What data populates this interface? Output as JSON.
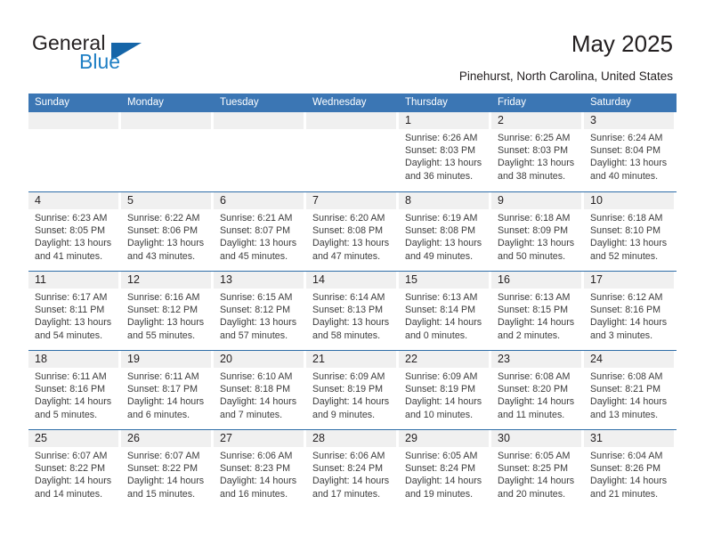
{
  "brand": {
    "name_top": "General",
    "name_bottom": "Blue",
    "triangle_color": "#1565a8",
    "blue_text_color": "#1f7fc4"
  },
  "header": {
    "title": "May 2025",
    "location": "Pinehurst, North Carolina, United States"
  },
  "colors": {
    "header_blue": "#3b76b4",
    "row_separator": "#2e6da8",
    "daynum_band": "#f0f0f0"
  },
  "weekdays": [
    "Sunday",
    "Monday",
    "Tuesday",
    "Wednesday",
    "Thursday",
    "Friday",
    "Saturday"
  ],
  "weeks": [
    [
      {
        "day": "",
        "empty": true,
        "sunrise": "",
        "sunset": "",
        "daylight_a": "",
        "daylight_b": ""
      },
      {
        "day": "",
        "empty": true,
        "sunrise": "",
        "sunset": "",
        "daylight_a": "",
        "daylight_b": ""
      },
      {
        "day": "",
        "empty": true,
        "sunrise": "",
        "sunset": "",
        "daylight_a": "",
        "daylight_b": ""
      },
      {
        "day": "",
        "empty": true,
        "sunrise": "",
        "sunset": "",
        "daylight_a": "",
        "daylight_b": ""
      },
      {
        "day": "1",
        "empty": false,
        "sunrise": "Sunrise: 6:26 AM",
        "sunset": "Sunset: 8:03 PM",
        "daylight_a": "Daylight: 13 hours",
        "daylight_b": "and 36 minutes."
      },
      {
        "day": "2",
        "empty": false,
        "sunrise": "Sunrise: 6:25 AM",
        "sunset": "Sunset: 8:03 PM",
        "daylight_a": "Daylight: 13 hours",
        "daylight_b": "and 38 minutes."
      },
      {
        "day": "3",
        "empty": false,
        "sunrise": "Sunrise: 6:24 AM",
        "sunset": "Sunset: 8:04 PM",
        "daylight_a": "Daylight: 13 hours",
        "daylight_b": "and 40 minutes."
      }
    ],
    [
      {
        "day": "4",
        "empty": false,
        "sunrise": "Sunrise: 6:23 AM",
        "sunset": "Sunset: 8:05 PM",
        "daylight_a": "Daylight: 13 hours",
        "daylight_b": "and 41 minutes."
      },
      {
        "day": "5",
        "empty": false,
        "sunrise": "Sunrise: 6:22 AM",
        "sunset": "Sunset: 8:06 PM",
        "daylight_a": "Daylight: 13 hours",
        "daylight_b": "and 43 minutes."
      },
      {
        "day": "6",
        "empty": false,
        "sunrise": "Sunrise: 6:21 AM",
        "sunset": "Sunset: 8:07 PM",
        "daylight_a": "Daylight: 13 hours",
        "daylight_b": "and 45 minutes."
      },
      {
        "day": "7",
        "empty": false,
        "sunrise": "Sunrise: 6:20 AM",
        "sunset": "Sunset: 8:08 PM",
        "daylight_a": "Daylight: 13 hours",
        "daylight_b": "and 47 minutes."
      },
      {
        "day": "8",
        "empty": false,
        "sunrise": "Sunrise: 6:19 AM",
        "sunset": "Sunset: 8:08 PM",
        "daylight_a": "Daylight: 13 hours",
        "daylight_b": "and 49 minutes."
      },
      {
        "day": "9",
        "empty": false,
        "sunrise": "Sunrise: 6:18 AM",
        "sunset": "Sunset: 8:09 PM",
        "daylight_a": "Daylight: 13 hours",
        "daylight_b": "and 50 minutes."
      },
      {
        "day": "10",
        "empty": false,
        "sunrise": "Sunrise: 6:18 AM",
        "sunset": "Sunset: 8:10 PM",
        "daylight_a": "Daylight: 13 hours",
        "daylight_b": "and 52 minutes."
      }
    ],
    [
      {
        "day": "11",
        "empty": false,
        "sunrise": "Sunrise: 6:17 AM",
        "sunset": "Sunset: 8:11 PM",
        "daylight_a": "Daylight: 13 hours",
        "daylight_b": "and 54 minutes."
      },
      {
        "day": "12",
        "empty": false,
        "sunrise": "Sunrise: 6:16 AM",
        "sunset": "Sunset: 8:12 PM",
        "daylight_a": "Daylight: 13 hours",
        "daylight_b": "and 55 minutes."
      },
      {
        "day": "13",
        "empty": false,
        "sunrise": "Sunrise: 6:15 AM",
        "sunset": "Sunset: 8:12 PM",
        "daylight_a": "Daylight: 13 hours",
        "daylight_b": "and 57 minutes."
      },
      {
        "day": "14",
        "empty": false,
        "sunrise": "Sunrise: 6:14 AM",
        "sunset": "Sunset: 8:13 PM",
        "daylight_a": "Daylight: 13 hours",
        "daylight_b": "and 58 minutes."
      },
      {
        "day": "15",
        "empty": false,
        "sunrise": "Sunrise: 6:13 AM",
        "sunset": "Sunset: 8:14 PM",
        "daylight_a": "Daylight: 14 hours",
        "daylight_b": "and 0 minutes."
      },
      {
        "day": "16",
        "empty": false,
        "sunrise": "Sunrise: 6:13 AM",
        "sunset": "Sunset: 8:15 PM",
        "daylight_a": "Daylight: 14 hours",
        "daylight_b": "and 2 minutes."
      },
      {
        "day": "17",
        "empty": false,
        "sunrise": "Sunrise: 6:12 AM",
        "sunset": "Sunset: 8:16 PM",
        "daylight_a": "Daylight: 14 hours",
        "daylight_b": "and 3 minutes."
      }
    ],
    [
      {
        "day": "18",
        "empty": false,
        "sunrise": "Sunrise: 6:11 AM",
        "sunset": "Sunset: 8:16 PM",
        "daylight_a": "Daylight: 14 hours",
        "daylight_b": "and 5 minutes."
      },
      {
        "day": "19",
        "empty": false,
        "sunrise": "Sunrise: 6:11 AM",
        "sunset": "Sunset: 8:17 PM",
        "daylight_a": "Daylight: 14 hours",
        "daylight_b": "and 6 minutes."
      },
      {
        "day": "20",
        "empty": false,
        "sunrise": "Sunrise: 6:10 AM",
        "sunset": "Sunset: 8:18 PM",
        "daylight_a": "Daylight: 14 hours",
        "daylight_b": "and 7 minutes."
      },
      {
        "day": "21",
        "empty": false,
        "sunrise": "Sunrise: 6:09 AM",
        "sunset": "Sunset: 8:19 PM",
        "daylight_a": "Daylight: 14 hours",
        "daylight_b": "and 9 minutes."
      },
      {
        "day": "22",
        "empty": false,
        "sunrise": "Sunrise: 6:09 AM",
        "sunset": "Sunset: 8:19 PM",
        "daylight_a": "Daylight: 14 hours",
        "daylight_b": "and 10 minutes."
      },
      {
        "day": "23",
        "empty": false,
        "sunrise": "Sunrise: 6:08 AM",
        "sunset": "Sunset: 8:20 PM",
        "daylight_a": "Daylight: 14 hours",
        "daylight_b": "and 11 minutes."
      },
      {
        "day": "24",
        "empty": false,
        "sunrise": "Sunrise: 6:08 AM",
        "sunset": "Sunset: 8:21 PM",
        "daylight_a": "Daylight: 14 hours",
        "daylight_b": "and 13 minutes."
      }
    ],
    [
      {
        "day": "25",
        "empty": false,
        "sunrise": "Sunrise: 6:07 AM",
        "sunset": "Sunset: 8:22 PM",
        "daylight_a": "Daylight: 14 hours",
        "daylight_b": "and 14 minutes."
      },
      {
        "day": "26",
        "empty": false,
        "sunrise": "Sunrise: 6:07 AM",
        "sunset": "Sunset: 8:22 PM",
        "daylight_a": "Daylight: 14 hours",
        "daylight_b": "and 15 minutes."
      },
      {
        "day": "27",
        "empty": false,
        "sunrise": "Sunrise: 6:06 AM",
        "sunset": "Sunset: 8:23 PM",
        "daylight_a": "Daylight: 14 hours",
        "daylight_b": "and 16 minutes."
      },
      {
        "day": "28",
        "empty": false,
        "sunrise": "Sunrise: 6:06 AM",
        "sunset": "Sunset: 8:24 PM",
        "daylight_a": "Daylight: 14 hours",
        "daylight_b": "and 17 minutes."
      },
      {
        "day": "29",
        "empty": false,
        "sunrise": "Sunrise: 6:05 AM",
        "sunset": "Sunset: 8:24 PM",
        "daylight_a": "Daylight: 14 hours",
        "daylight_b": "and 19 minutes."
      },
      {
        "day": "30",
        "empty": false,
        "sunrise": "Sunrise: 6:05 AM",
        "sunset": "Sunset: 8:25 PM",
        "daylight_a": "Daylight: 14 hours",
        "daylight_b": "and 20 minutes."
      },
      {
        "day": "31",
        "empty": false,
        "sunrise": "Sunrise: 6:04 AM",
        "sunset": "Sunset: 8:26 PM",
        "daylight_a": "Daylight: 14 hours",
        "daylight_b": "and 21 minutes."
      }
    ]
  ]
}
